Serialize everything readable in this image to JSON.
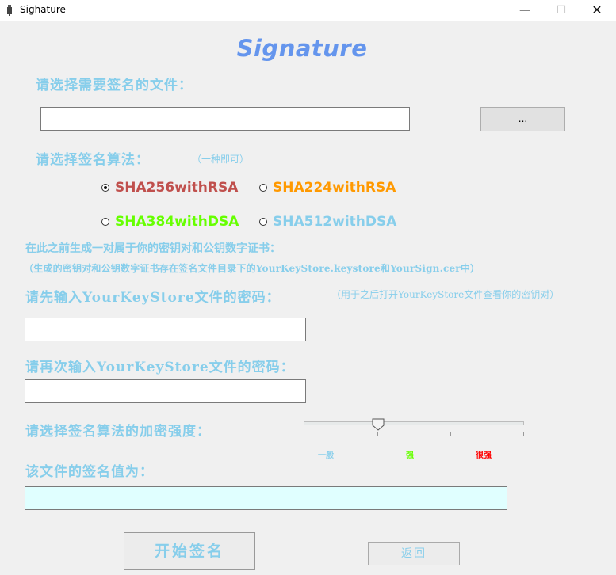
{
  "window": {
    "title": "Sighature",
    "minimize_glyph": "—",
    "maximize_glyph": "☐",
    "close_glyph": "✕"
  },
  "heading": "Signature",
  "file": {
    "label": "请选择需要签名的文件：",
    "path_value": "",
    "browse_label": "..."
  },
  "algorithm": {
    "label": "请选择签名算法：",
    "hint": "（一种即可）",
    "options": [
      {
        "label": "SHA256withRSA",
        "selected": true,
        "color": "#c0504d"
      },
      {
        "label": "SHA224withRSA",
        "selected": false,
        "color": "#ff9900"
      },
      {
        "label": "SHA384withDSA",
        "selected": false,
        "color": "#66ff00"
      },
      {
        "label": "SHA512withDSA",
        "selected": false,
        "color": "#87ceeb"
      }
    ]
  },
  "info": {
    "line1": "在此之前生成一对属于你的密钥对和公钥数字证书：",
    "line2": "（生成的密钥对和公钥数字证书存在签名文件目录下的YourKeyStore.keystore和YourSign.cer中）"
  },
  "password": {
    "label": "请先输入YourKeyStore文件的密码：",
    "hint": "（用于之后打开YourKeyStore文件查看你的密钥对）",
    "value": ""
  },
  "confirm_password": {
    "label": "请再次输入YourKeyStore文件的密码：",
    "value": ""
  },
  "strength": {
    "label": "请选择签名算法的加密强度：",
    "levels": [
      {
        "label": "一般",
        "color": "#87ceeb"
      },
      {
        "label": "强",
        "color": "#66ff00"
      },
      {
        "label": "很强",
        "color": "#ff0000"
      }
    ],
    "value_fraction": 0.33
  },
  "result": {
    "label": "该文件的签名值为：",
    "value": "",
    "background": "#e0ffff"
  },
  "buttons": {
    "start": "开始签名",
    "back": "返回"
  },
  "colors": {
    "label": "#87ceeb",
    "heading": "#6495ed"
  }
}
